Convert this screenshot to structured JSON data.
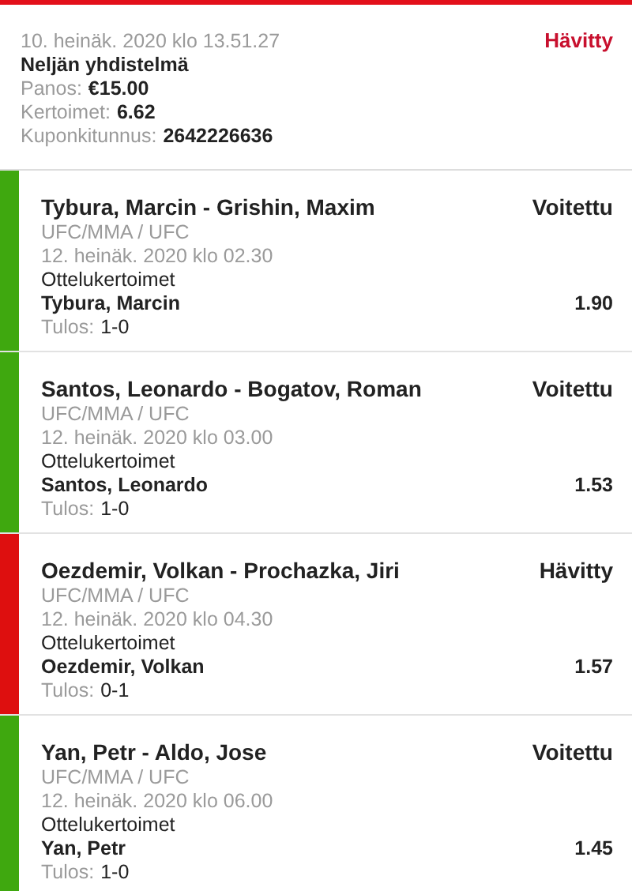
{
  "coupon": {
    "date": "10. heinäk. 2020 klo 13.51.27",
    "status": "Hävitty",
    "kind": "lost",
    "type": "Neljän yhdistelmä",
    "details": [
      {
        "label": "Panos:",
        "value": "€15.00"
      },
      {
        "label": "Kertoimet:",
        "value": "6.62"
      },
      {
        "label": "Kuponkitunnus:",
        "value": "2642226636"
      }
    ]
  },
  "legs": [
    {
      "kind": "won",
      "match": "Tybura, Marcin - Grishin, Maxim",
      "status": "Voitettu",
      "category": "UFC/MMA / UFC",
      "time": "12. heinäk. 2020 klo 02.30",
      "market": "Ottelukertoimet",
      "pick": "Tybura, Marcin",
      "odds": "1.90",
      "result_label": "Tulos:",
      "result": "1-0"
    },
    {
      "kind": "won",
      "match": "Santos, Leonardo - Bogatov, Roman",
      "status": "Voitettu",
      "category": "UFC/MMA / UFC",
      "time": "12. heinäk. 2020 klo 03.00",
      "market": "Ottelukertoimet",
      "pick": "Santos, Leonardo",
      "odds": "1.53",
      "result_label": "Tulos:",
      "result": "1-0"
    },
    {
      "kind": "lost",
      "match": "Oezdemir, Volkan - Prochazka, Jiri",
      "status": "Hävitty",
      "category": "UFC/MMA / UFC",
      "time": "12. heinäk. 2020 klo 04.30",
      "market": "Ottelukertoimet",
      "pick": "Oezdemir, Volkan",
      "odds": "1.57",
      "result_label": "Tulos:",
      "result": "0-1"
    },
    {
      "kind": "won",
      "match": "Yan, Petr - Aldo, Jose",
      "status": "Voitettu",
      "category": "UFC/MMA / UFC",
      "time": "12. heinäk. 2020 klo 06.00",
      "market": "Ottelukertoimet",
      "pick": "Yan, Petr",
      "odds": "1.45",
      "result_label": "Tulos:",
      "result": "1-0"
    }
  ]
}
